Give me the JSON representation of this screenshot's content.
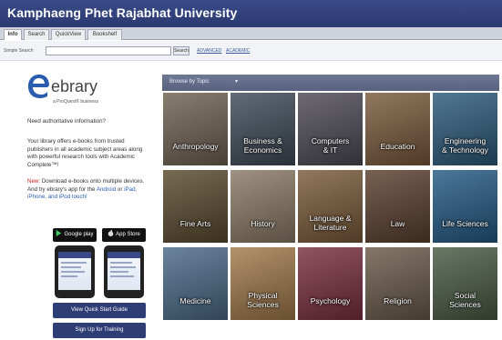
{
  "header": {
    "title": "Kamphaeng Phet Rajabhat University"
  },
  "tabs": [
    {
      "label": "Info"
    },
    {
      "label": "Search"
    },
    {
      "label": "QuickView"
    },
    {
      "label": "Bookshelf"
    }
  ],
  "search": {
    "label": "Simple Search",
    "button": "Search",
    "link_advanced": "ADVANCED",
    "link_academic": "ACADEMIC"
  },
  "logo": {
    "word": "ebrary",
    "sub": "a ProQuest® business"
  },
  "left": {
    "question": "Need authoritative information?",
    "body": "Your library offers e-books from trusted publishers in all academic subject areas along with powerful research tools with Academic Complete™!",
    "new_word": "New:",
    "new_text": "Download e-books onto multiple devices. And try ebrary's app for the",
    "android": "Android",
    "or": "or",
    "ipad": "iPad, iPhone, and iPod touch!"
  },
  "badges": {
    "google": "Google play",
    "apple": "App Store"
  },
  "buttons": {
    "quick_start": "View Quick Start Guide",
    "training": "Sign Up for Training"
  },
  "browse": {
    "label": "Browse by Topic",
    "caret": "▾"
  },
  "topics": [
    {
      "l1": "Anthropology",
      "l2": "",
      "color": "#6f6152"
    },
    {
      "l1": "Business &",
      "l2": "Economics",
      "color": "#3f4a58"
    },
    {
      "l1": "Computers",
      "l2": "& IT",
      "color": "#4d4a55"
    },
    {
      "l1": "Education",
      "l2": "",
      "color": "#7a5a3c"
    },
    {
      "l1": "Engineering",
      "l2": "& Technology",
      "color": "#2d5a7a"
    },
    {
      "l1": "Fine Arts",
      "l2": "",
      "color": "#5a4a2e"
    },
    {
      "l1": "History",
      "l2": "",
      "color": "#8a7a66"
    },
    {
      "l1": "Language &",
      "l2": "Literature",
      "color": "#7a5a3a"
    },
    {
      "l1": "Law",
      "l2": "",
      "color": "#5a3f2e"
    },
    {
      "l1": "Life Sciences",
      "l2": "",
      "color": "#245a84"
    },
    {
      "l1": "Medicine",
      "l2": "",
      "color": "#4a6a88"
    },
    {
      "l1": "Physical",
      "l2": "Sciences",
      "color": "#a07a4a"
    },
    {
      "l1": "Psychology",
      "l2": "",
      "color": "#7a2f3f"
    },
    {
      "l1": "Religion",
      "l2": "",
      "color": "#6a5a4a"
    },
    {
      "l1": "Social",
      "l2": "Sciences",
      "color": "#4a5a44"
    }
  ]
}
